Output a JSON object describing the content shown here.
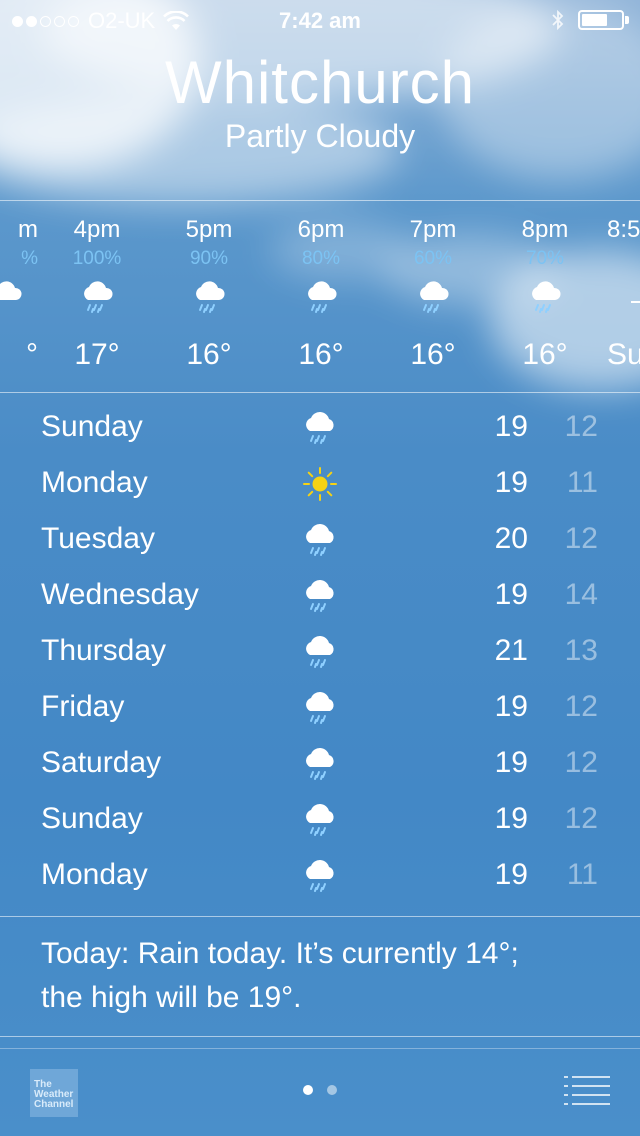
{
  "status_bar": {
    "carrier": "O2-UK",
    "time": "7:42 am",
    "signal_bars": 2,
    "battery_level": 0.65
  },
  "header": {
    "city": "Whitchurch",
    "condition": "Partly Cloudy"
  },
  "hourly": [
    {
      "time": "m",
      "precip": "%",
      "temp": "°",
      "icon": "rain-cloud-icon"
    },
    {
      "time": "4pm",
      "precip": "100%",
      "temp": "17°",
      "icon": "rain-cloud-icon"
    },
    {
      "time": "5pm",
      "precip": "90%",
      "temp": "16°",
      "icon": "rain-cloud-icon"
    },
    {
      "time": "6pm",
      "precip": "80%",
      "temp": "16°",
      "icon": "rain-cloud-icon"
    },
    {
      "time": "7pm",
      "precip": "60%",
      "temp": "16°",
      "icon": "rain-cloud-icon"
    },
    {
      "time": "8pm",
      "precip": "70%",
      "temp": "16°",
      "icon": "rain-cloud-icon"
    },
    {
      "time": "8:5",
      "precip": "",
      "temp": "Su",
      "icon": "sunset-icon"
    }
  ],
  "daily": [
    {
      "day": "Sunday",
      "icon": "rain-cloud-icon",
      "high": "19",
      "low": "12"
    },
    {
      "day": "Monday",
      "icon": "sun-icon",
      "high": "19",
      "low": "11"
    },
    {
      "day": "Tuesday",
      "icon": "rain-cloud-icon",
      "high": "20",
      "low": "12"
    },
    {
      "day": "Wednesday",
      "icon": "rain-cloud-icon",
      "high": "19",
      "low": "14"
    },
    {
      "day": "Thursday",
      "icon": "rain-cloud-icon",
      "high": "21",
      "low": "13"
    },
    {
      "day": "Friday",
      "icon": "rain-cloud-icon",
      "high": "19",
      "low": "12"
    },
    {
      "day": "Saturday",
      "icon": "rain-cloud-icon",
      "high": "19",
      "low": "12"
    },
    {
      "day": "Sunday",
      "icon": "rain-cloud-icon",
      "high": "19",
      "low": "12"
    },
    {
      "day": "Monday",
      "icon": "rain-cloud-icon",
      "high": "19",
      "low": "11"
    }
  ],
  "summary": {
    "line1": "Today: Rain today. It’s currently 14°;",
    "line2": "the high will be 19°."
  },
  "footer": {
    "logo_text": [
      "The",
      "Weather",
      "Channel"
    ],
    "page_count": 2,
    "current_page": 1
  },
  "colors": {
    "precip": "#7cc3f3",
    "sun": "#f5d214",
    "low_temp": "rgba(255,255,255,0.45)"
  }
}
